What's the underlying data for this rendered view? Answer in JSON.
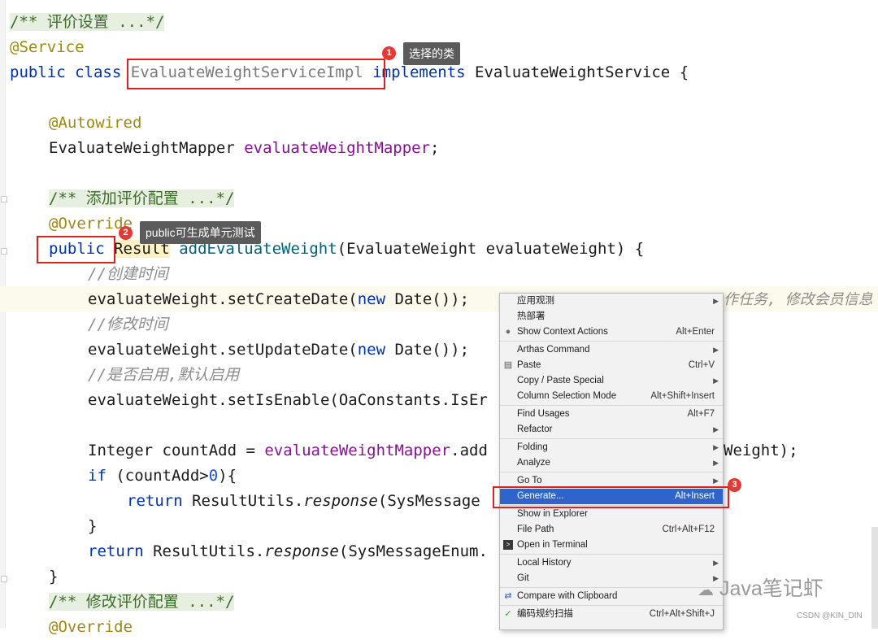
{
  "code": {
    "l1": "/** 评价设置 ...*/",
    "l2": "@Service",
    "l3_kw1": "public",
    "l3_kw2": "class",
    "l3_cls": "EvaluateWeightServiceImpl",
    "l3_impl": "implements",
    "l3_rest": "EvaluateWeightService {",
    "l5": "@Autowired",
    "l6_type": "EvaluateWeightMapper",
    "l6_field": "evaluateWeightMapper",
    "l6_semi": ";",
    "l8": "/** 添加评价配置 ...*/",
    "l9": "@Override",
    "l10_kw": "public",
    "l10_type": "Result",
    "l10_method": "addEvaluateWeight",
    "l10_rest": "(EvaluateWeight evaluateWeight) {",
    "l11": "//创建时间",
    "l12_a": "evaluateWeight.setCreateDate(",
    "l12_new": "new",
    "l12_b": " Date());",
    "l12_hint": "作任务, 修改会员信息",
    "l13": "//修改时间",
    "l14_a": "evaluateWeight.setUpdateDate(",
    "l14_new": "new",
    "l14_b": " Date());",
    "l15": "//是否启用,默认启用",
    "l16": "evaluateWeight.setIsEnable(OaConstants.IsEr",
    "l18_a": "Integer countAdd = ",
    "l18_field": "evaluateWeightMapper",
    "l18_b": ".add",
    "l18_tail": "Weight);",
    "l19_kw": "if",
    "l19_a": " (countAdd>",
    "l19_num": "0",
    "l19_b": "){",
    "l20_kw": "return",
    "l20_a": " ResultUtils.",
    "l20_m": "response",
    "l20_b": "(SysMessage",
    "l21": "}",
    "l22_kw": "return",
    "l22_a": " ResultUtils.",
    "l22_m": "response",
    "l22_b": "(SysMessageEnum.",
    "l23": "}",
    "l24": "/** 修改评价配置 ...*/",
    "l25": "@Override"
  },
  "annotations": {
    "badge1": "1",
    "tip1": "选择的类",
    "badge2": "2",
    "tip2": "public可生成单元测试",
    "badge3": "3"
  },
  "menu": {
    "items": [
      {
        "label": "应用观测",
        "shortcut": "",
        "submenu": true
      },
      {
        "label": "热部署",
        "shortcut": "",
        "submenu": false
      },
      {
        "label": "Show Context Actions",
        "shortcut": "Alt+Enter",
        "submenu": false,
        "icon": "bulb-icon"
      },
      {
        "label": "Arthas Command",
        "shortcut": "",
        "submenu": true
      },
      {
        "label": "Paste",
        "shortcut": "Ctrl+V",
        "submenu": false,
        "icon": "paste-icon"
      },
      {
        "label": "Copy / Paste Special",
        "shortcut": "",
        "submenu": true
      },
      {
        "label": "Column Selection Mode",
        "shortcut": "Alt+Shift+Insert",
        "submenu": false
      },
      {
        "label": "Find Usages",
        "shortcut": "Alt+F7",
        "submenu": false
      },
      {
        "label": "Refactor",
        "shortcut": "",
        "submenu": true
      },
      {
        "label": "Folding",
        "shortcut": "",
        "submenu": true
      },
      {
        "label": "Analyze",
        "shortcut": "",
        "submenu": true
      },
      {
        "label": "Go To",
        "shortcut": "",
        "submenu": true
      },
      {
        "label": "Generate...",
        "shortcut": "Alt+Insert",
        "submenu": false
      },
      {
        "label": "Show in Explorer",
        "shortcut": "",
        "submenu": false
      },
      {
        "label": "File Path",
        "shortcut": "Ctrl+Alt+F12",
        "submenu": false
      },
      {
        "label": "Open in Terminal",
        "shortcut": "",
        "submenu": false,
        "icon": "terminal-icon"
      },
      {
        "label": "Local History",
        "shortcut": "",
        "submenu": true
      },
      {
        "label": "Git",
        "shortcut": "",
        "submenu": true
      },
      {
        "label": "Compare with Clipboard",
        "shortcut": "",
        "submenu": false,
        "icon": "compare-icon"
      },
      {
        "label": "编码规约扫描",
        "shortcut": "Ctrl+Alt+Shift+J",
        "submenu": false,
        "icon": "scan-icon"
      }
    ],
    "selected": "Generate...",
    "arrow": "▶"
  },
  "watermark": {
    "brand": "Java笔记虾",
    "source": "CSDN @KIN_DIN"
  },
  "colors": {
    "keyword": "#0033b3",
    "annotation": "#9e880d",
    "field": "#871094",
    "method": "#00627a",
    "comment": "#8c8c8c",
    "highlight_box": "#e02020",
    "menu_selected": "#2f65ca"
  }
}
